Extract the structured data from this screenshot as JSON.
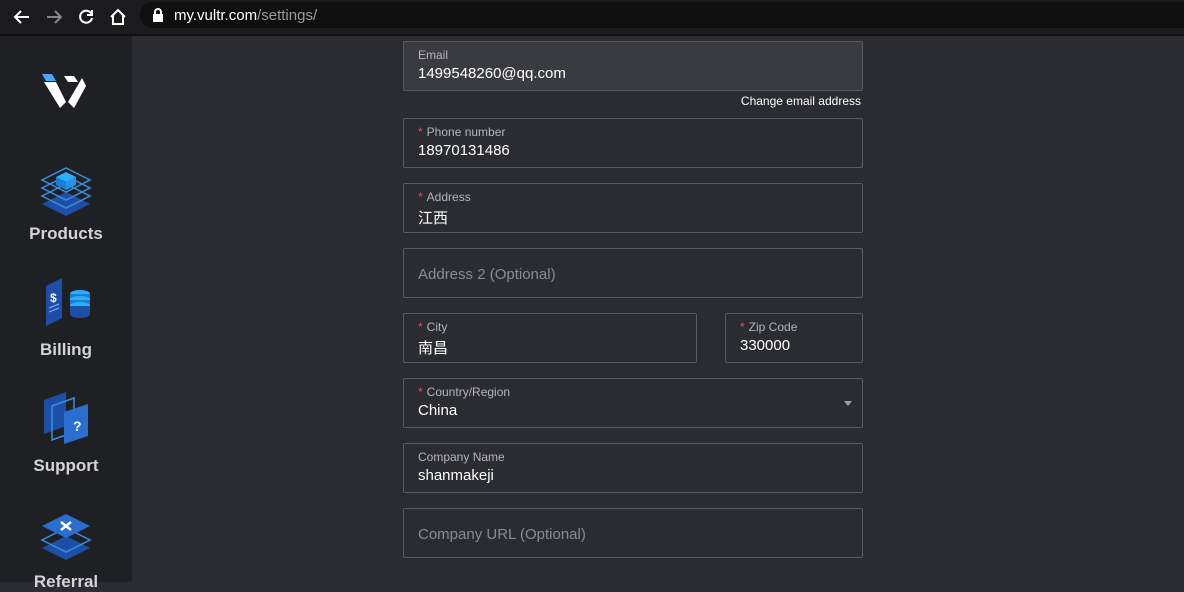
{
  "browser": {
    "url_host": "my.vultr.com",
    "url_path": "/settings/"
  },
  "sidebar": {
    "items": [
      {
        "label": "Products",
        "icon": "products-icon"
      },
      {
        "label": "Billing",
        "icon": "billing-icon"
      },
      {
        "label": "Support",
        "icon": "support-icon"
      },
      {
        "label": "Referral",
        "icon": "referral-icon"
      }
    ]
  },
  "form": {
    "email": {
      "label": "Email",
      "value": "1499548260@qq.com"
    },
    "change_email_label": "Change email address",
    "phone": {
      "label": "Phone number",
      "value": "18970131486",
      "required_mark": "*"
    },
    "address": {
      "label": "Address",
      "value": "江西",
      "required_mark": "*"
    },
    "address2": {
      "placeholder": "Address 2 (Optional)"
    },
    "city": {
      "label": "City",
      "value": "南昌",
      "required_mark": "*"
    },
    "zip": {
      "label": "Zip Code",
      "value": "330000",
      "required_mark": "*"
    },
    "country": {
      "label": "Country/Region",
      "value": "China",
      "required_mark": "*"
    },
    "company_name": {
      "label": "Company Name",
      "value": "shanmakeji"
    },
    "company_url": {
      "placeholder": "Company URL (Optional)"
    }
  },
  "colors": {
    "required": "#e0525a",
    "accent": "#1e90ff"
  }
}
